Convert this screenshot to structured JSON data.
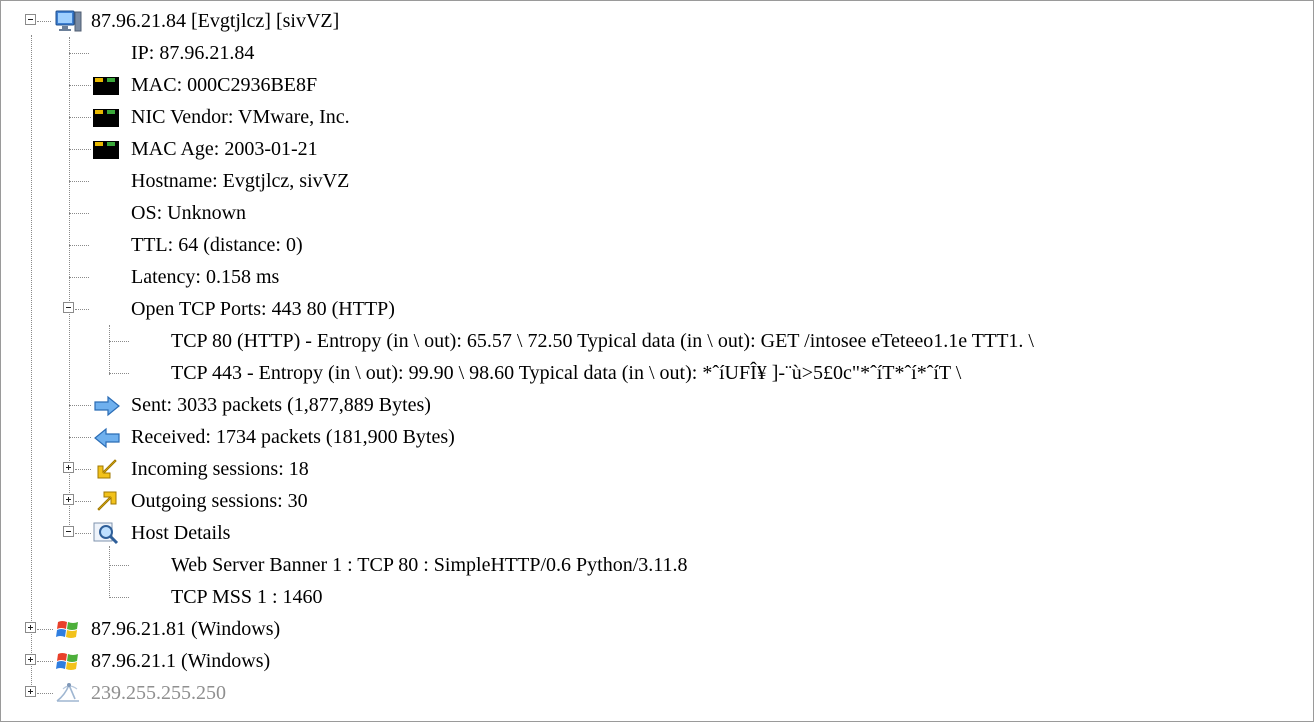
{
  "tree": {
    "host_main": {
      "label": "87.96.21.84 [Evgtjlcz] [sivVZ]",
      "icon": "computer-icon",
      "children": {
        "ip": "IP: 87.96.21.84",
        "mac": "MAC: 000C2936BE8F",
        "nic_vendor": "NIC Vendor: VMware, Inc.",
        "mac_age": "MAC Age: 2003-01-21",
        "hostname": "Hostname: Evgtjlcz, sivVZ",
        "os": "OS: Unknown",
        "ttl": "TTL: 64 (distance: 0)",
        "latency": "Latency: 0.158 ms",
        "open_tcp_ports": {
          "label": "Open TCP Ports: 443 80 (HTTP)",
          "items": [
            "TCP 80 (HTTP) - Entropy (in \\ out): 65.57 \\ 72.50 Typical data (in \\ out): GET /intosee eTeteeo1.1e  TTT1.  \\",
            "TCP 443 - Entropy (in \\ out): 99.90 \\ 98.60 Typical data (in \\ out): *ˆíUFÎ¥ ]-¨ù>5£0c\"*ˆíT*ˆí*ˆíT \\"
          ]
        },
        "sent": "Sent: 3033 packets (1,877,889 Bytes)",
        "received": "Received: 1734 packets (181,900 Bytes)",
        "incoming_sessions": "Incoming sessions: 18",
        "outgoing_sessions": "Outgoing sessions: 30",
        "host_details": {
          "label": "Host Details",
          "items": [
            "Web Server Banner 1 : TCP 80 : SimpleHTTP/0.6 Python/3.11.8",
            "TCP MSS 1 : 1460"
          ]
        }
      }
    },
    "hosts": [
      {
        "label": "87.96.21.81 (Windows)",
        "icon": "windows-icon"
      },
      {
        "label": "87.96.21.1 (Windows)",
        "icon": "windows-icon"
      },
      {
        "label": "239.255.255.250",
        "icon": "multicast-icon"
      }
    ]
  },
  "colors": {
    "text": "#000000",
    "muted_text": "#8f8f8f",
    "tree_lines": "#8a8a8a",
    "sent_arrow": "#5b9bd5",
    "received_arrow": "#5b9bd5",
    "session_arrow": "#e8b400"
  }
}
